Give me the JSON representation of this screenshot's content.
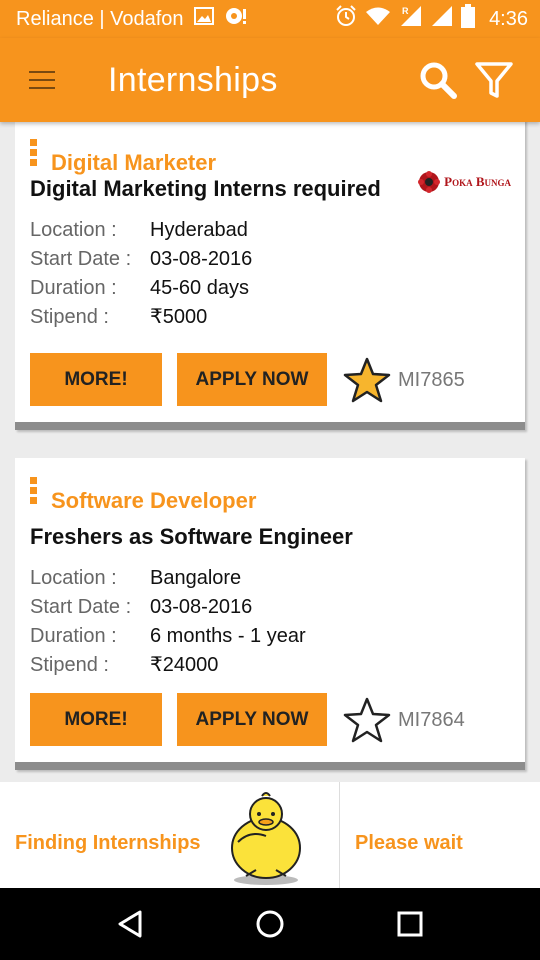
{
  "status_bar": {
    "carrier": "Reliance | Vodafon",
    "time": "4:36",
    "icons": [
      "image-icon",
      "sync-icon",
      "alarm-icon",
      "wifi-icon",
      "signal-icon",
      "signal-icon",
      "battery-icon"
    ]
  },
  "app_bar": {
    "title": "Internships",
    "menu_icon": "hamburger-menu-icon",
    "search_icon": "search-icon",
    "filter_icon": "filter-icon"
  },
  "colors": {
    "accent": "#f7941d",
    "card_border": "#8c8c8c",
    "star_filled": "#f7b52d"
  },
  "labels": {
    "location": "Location :",
    "start_date": "Start Date :",
    "duration": "Duration :",
    "stipend": "Stipend :",
    "more": "MORE!",
    "apply": "APPLY NOW"
  },
  "internships": [
    {
      "category": "Digital Marketer",
      "title": "Digital Marketing Interns required",
      "location": "Hyderabad",
      "start_date": "03-08-2016",
      "duration": "45-60 days",
      "stipend": "₹5000",
      "code": "MI7865",
      "starred": true,
      "logo_text": "Poka Bunga"
    },
    {
      "category": "Software Developer",
      "title": "Freshers as Software Engineer",
      "location": "Bangalore",
      "start_date": "03-08-2016",
      "duration": "6 months - 1 year",
      "stipend": "₹24000",
      "code": "MI7864",
      "starred": false
    }
  ],
  "loading": {
    "left_text": "Finding Internships",
    "right_text": "Please wait",
    "mascot_icon": "duck-mascot-icon"
  },
  "nav_bar": {
    "back_icon": "back-triangle-icon",
    "home_icon": "home-circle-icon",
    "recents_icon": "recents-square-icon"
  }
}
